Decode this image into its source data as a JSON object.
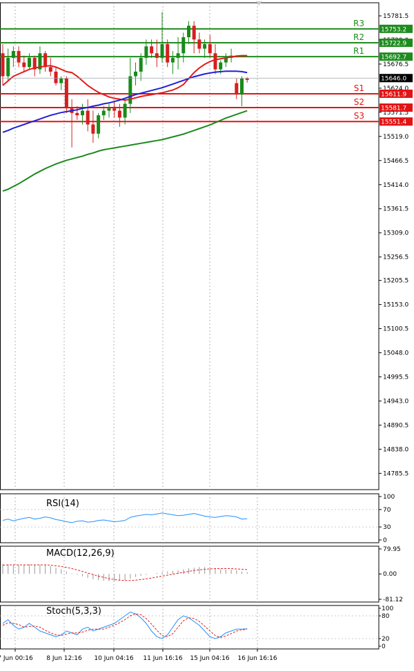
{
  "chart_data": {
    "type": "candlestick",
    "symbol_timeframe": "",
    "price_axis": {
      "ylim": [
        14750,
        15810
      ],
      "tick_labels": [
        "15781.5",
        "15729.0",
        "15676.5",
        "15624.0",
        "15571.5",
        "15519.0",
        "15466.5",
        "15414.0",
        "15361.5",
        "15309.0",
        "15256.5",
        "15205.5",
        "15153.0",
        "15100.5",
        "15048.0",
        "14995.5",
        "14943.0",
        "14890.5",
        "14838.0",
        "14785.5"
      ],
      "current_price": "15646.0"
    },
    "x_axis": {
      "tick_labels": [
        "7 Jun 00:16",
        "8 Jun 12:16",
        "10 Jun 04:16",
        "11 Jun 16:16",
        "15 Jun 04:16",
        "16 Jun 16:16"
      ]
    },
    "levels": [
      {
        "name": "R3",
        "value": "15753.2",
        "color": "#1e8b1e"
      },
      {
        "name": "R2",
        "value": "15722.9",
        "color": "#1e8b1e"
      },
      {
        "name": "R1",
        "value": "15692.7",
        "color": "#1e8b1e"
      },
      {
        "name": "S1",
        "value": "15611.9",
        "color": "#e11414"
      },
      {
        "name": "S2",
        "value": "15581.7",
        "color": "#e11414"
      },
      {
        "name": "S3",
        "value": "15551.4",
        "color": "#e11414"
      }
    ],
    "candles": [
      {
        "o": 15700,
        "h": 15720,
        "l": 15630,
        "c": 15650
      },
      {
        "o": 15650,
        "h": 15710,
        "l": 15640,
        "c": 15690
      },
      {
        "o": 15690,
        "h": 15715,
        "l": 15670,
        "c": 15705
      },
      {
        "o": 15705,
        "h": 15715,
        "l": 15670,
        "c": 15680
      },
      {
        "o": 15680,
        "h": 15695,
        "l": 15660,
        "c": 15670
      },
      {
        "o": 15670,
        "h": 15700,
        "l": 15665,
        "c": 15690
      },
      {
        "o": 15690,
        "h": 15695,
        "l": 15650,
        "c": 15665
      },
      {
        "o": 15665,
        "h": 15715,
        "l": 15655,
        "c": 15700
      },
      {
        "o": 15700,
        "h": 15705,
        "l": 15660,
        "c": 15670
      },
      {
        "o": 15670,
        "h": 15690,
        "l": 15650,
        "c": 15660
      },
      {
        "o": 15660,
        "h": 15670,
        "l": 15630,
        "c": 15635
      },
      {
        "o": 15635,
        "h": 15650,
        "l": 15620,
        "c": 15645
      },
      {
        "o": 15645,
        "h": 15650,
        "l": 15570,
        "c": 15580
      },
      {
        "o": 15580,
        "h": 15600,
        "l": 15495,
        "c": 15570
      },
      {
        "o": 15570,
        "h": 15585,
        "l": 15555,
        "c": 15565
      },
      {
        "o": 15565,
        "h": 15590,
        "l": 15545,
        "c": 15575
      },
      {
        "o": 15575,
        "h": 15600,
        "l": 15530,
        "c": 15545
      },
      {
        "o": 15545,
        "h": 15575,
        "l": 15505,
        "c": 15525
      },
      {
        "o": 15525,
        "h": 15570,
        "l": 15515,
        "c": 15565
      },
      {
        "o": 15565,
        "h": 15585,
        "l": 15555,
        "c": 15575
      },
      {
        "o": 15575,
        "h": 15590,
        "l": 15560,
        "c": 15580
      },
      {
        "o": 15580,
        "h": 15595,
        "l": 15560,
        "c": 15575
      },
      {
        "o": 15575,
        "h": 15590,
        "l": 15540,
        "c": 15560
      },
      {
        "o": 15560,
        "h": 15600,
        "l": 15545,
        "c": 15590
      },
      {
        "o": 15590,
        "h": 15690,
        "l": 15570,
        "c": 15650
      },
      {
        "o": 15650,
        "h": 15680,
        "l": 15630,
        "c": 15660
      },
      {
        "o": 15660,
        "h": 15700,
        "l": 15640,
        "c": 15690
      },
      {
        "o": 15690,
        "h": 15730,
        "l": 15675,
        "c": 15715
      },
      {
        "o": 15715,
        "h": 15730,
        "l": 15690,
        "c": 15700
      },
      {
        "o": 15700,
        "h": 15730,
        "l": 15670,
        "c": 15690
      },
      {
        "o": 15690,
        "h": 15790,
        "l": 15680,
        "c": 15720
      },
      {
        "o": 15720,
        "h": 15730,
        "l": 15670,
        "c": 15680
      },
      {
        "o": 15680,
        "h": 15705,
        "l": 15655,
        "c": 15690
      },
      {
        "o": 15690,
        "h": 15735,
        "l": 15665,
        "c": 15700
      },
      {
        "o": 15700,
        "h": 15745,
        "l": 15680,
        "c": 15735
      },
      {
        "o": 15735,
        "h": 15770,
        "l": 15720,
        "c": 15760
      },
      {
        "o": 15760,
        "h": 15770,
        "l": 15700,
        "c": 15730
      },
      {
        "o": 15730,
        "h": 15745,
        "l": 15700,
        "c": 15710
      },
      {
        "o": 15710,
        "h": 15730,
        "l": 15690,
        "c": 15720
      },
      {
        "o": 15720,
        "h": 15740,
        "l": 15690,
        "c": 15700
      },
      {
        "o": 15700,
        "h": 15720,
        "l": 15655,
        "c": 15665
      },
      {
        "o": 15665,
        "h": 15685,
        "l": 15655,
        "c": 15680
      },
      {
        "o": 15680,
        "h": 15700,
        "l": 15670,
        "c": 15690
      },
      {
        "o": 15690,
        "h": 15710,
        "l": 15680,
        "c": 15695
      },
      {
        "o": 15635,
        "h": 15645,
        "l": 15600,
        "c": 15610
      },
      {
        "o": 15610,
        "h": 15650,
        "l": 15585,
        "c": 15645
      },
      {
        "o": 15645,
        "h": 15648,
        "l": 15636,
        "c": 15642
      }
    ],
    "moving_averages": [
      {
        "color": "#e31b1b",
        "values": [
          15630,
          15640,
          15650,
          15655,
          15660,
          15665,
          15668,
          15670,
          15672,
          15673,
          15670,
          15665,
          15660,
          15658,
          15650,
          15640,
          15630,
          15622,
          15615,
          15610,
          15605,
          15602,
          15600,
          15598,
          15600,
          15603,
          15606,
          15608,
          15610,
          15612,
          15614,
          15617,
          15620,
          15625,
          15632,
          15645,
          15658,
          15668,
          15676,
          15682,
          15686,
          15688,
          15690,
          15692,
          15694,
          15695,
          15695
        ]
      },
      {
        "color": "#1f1fd8",
        "values": [
          15528,
          15532,
          15537,
          15541,
          15545,
          15549,
          15553,
          15557,
          15561,
          15565,
          15568,
          15571,
          15573,
          15575,
          15577,
          15580,
          15582,
          15585,
          15587,
          15590,
          15592,
          15595,
          15598,
          15602,
          15606,
          15610,
          15613,
          15616,
          15619,
          15622,
          15625,
          15629,
          15633,
          15637,
          15641,
          15645,
          15649,
          15652,
          15655,
          15657,
          15659,
          15660,
          15661,
          15661,
          15661,
          15660,
          15658
        ]
      },
      {
        "color": "#1a8a1a",
        "values": [
          15400,
          15404,
          15410,
          15416,
          15423,
          15430,
          15437,
          15443,
          15449,
          15454,
          15459,
          15463,
          15467,
          15470,
          15473,
          15476,
          15480,
          15483,
          15487,
          15490,
          15492,
          15494,
          15496,
          15498,
          15500,
          15502,
          15504,
          15506,
          15508,
          15510,
          15512,
          15515,
          15518,
          15521,
          15524,
          15528,
          15532,
          15536,
          15540,
          15544,
          15549,
          15554,
          15559,
          15563,
          15567,
          15571,
          15575
        ]
      }
    ],
    "indicators": [
      {
        "name": "RSI(14)",
        "tick_labels": [
          "100",
          "70",
          "30",
          "0"
        ],
        "line_color": "#1e90ff",
        "values": [
          45,
          48,
          44,
          47,
          50,
          52,
          48,
          50,
          53,
          51,
          47,
          45,
          42,
          40,
          43,
          44,
          41,
          42,
          45,
          46,
          44,
          42,
          43,
          45,
          52,
          55,
          57,
          59,
          58,
          60,
          62,
          60,
          58,
          56,
          57,
          59,
          61,
          58,
          55,
          53,
          52,
          54,
          56,
          55,
          53,
          48,
          49
        ]
      },
      {
        "name": "MACD(12,26,9)",
        "tick_labels": [
          "79.95",
          "0.00",
          "-81.12"
        ],
        "bar_color": "#a8a8a8",
        "signal_color": "#e31b1b",
        "histogram": [
          33,
          31,
          28,
          29,
          30,
          31,
          30,
          29,
          28,
          25,
          20,
          15,
          8,
          2,
          -3,
          -8,
          -13,
          -17,
          -20,
          -22,
          -23,
          -23,
          -22,
          -20,
          -15,
          -10,
          -6,
          -3,
          0,
          3,
          6,
          8,
          10,
          12,
          15,
          18,
          20,
          22,
          22,
          20,
          17,
          15,
          14,
          14,
          12,
          8,
          6
        ],
        "signal": [
          28,
          29,
          29,
          29,
          29,
          29,
          29,
          29,
          29,
          28,
          26,
          24,
          21,
          17,
          13,
          8,
          3,
          -2,
          -7,
          -11,
          -15,
          -18,
          -20,
          -21,
          -21,
          -20,
          -18,
          -16,
          -13,
          -10,
          -7,
          -4,
          -1,
          2,
          5,
          8,
          11,
          13,
          15,
          16,
          17,
          17,
          17,
          17,
          16,
          15,
          14
        ]
      },
      {
        "name": "Stoch(5,3,3)",
        "tick_labels": [
          "100",
          "80",
          "20",
          "0"
        ],
        "k_color": "#1e90ff",
        "d_color": "#e31b1b",
        "k": [
          60,
          70,
          55,
          45,
          50,
          60,
          50,
          40,
          35,
          30,
          25,
          30,
          40,
          35,
          30,
          45,
          50,
          40,
          45,
          50,
          55,
          60,
          70,
          80,
          90,
          85,
          75,
          60,
          40,
          25,
          20,
          30,
          50,
          70,
          80,
          75,
          65,
          55,
          40,
          25,
          20,
          25,
          35,
          40,
          45,
          45,
          46
        ],
        "d": [
          55,
          62,
          60,
          57,
          50,
          52,
          53,
          50,
          42,
          35,
          30,
          28,
          32,
          35,
          35,
          37,
          42,
          45,
          45,
          45,
          50,
          55,
          62,
          70,
          80,
          85,
          83,
          73,
          58,
          42,
          28,
          25,
          33,
          50,
          67,
          75,
          73,
          65,
          53,
          40,
          28,
          23,
          27,
          33,
          40,
          43,
          45
        ]
      }
    ]
  }
}
